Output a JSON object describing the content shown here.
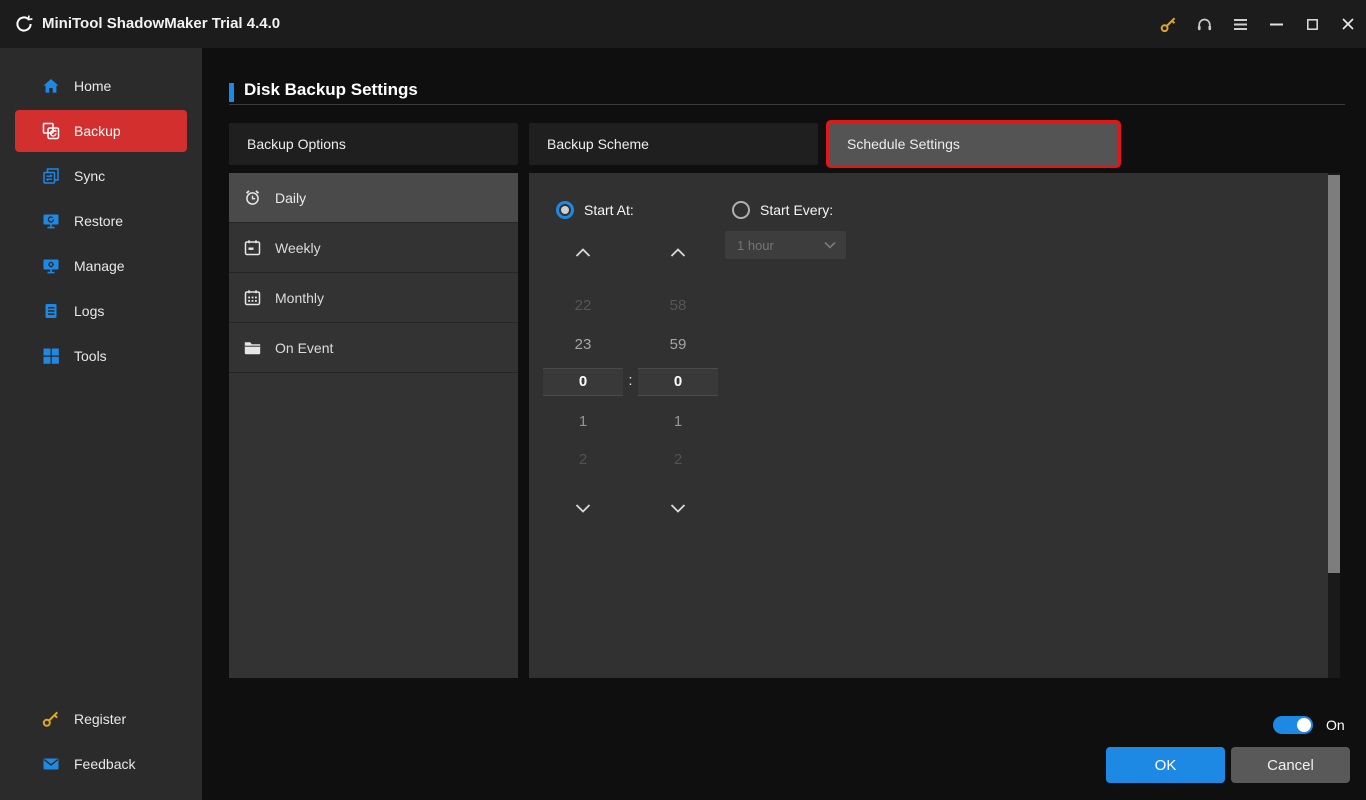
{
  "titlebar": {
    "title": "MiniTool ShadowMaker Trial 4.4.0",
    "icons": [
      "key-icon",
      "headset-icon",
      "menu-icon",
      "minimize-icon",
      "maximize-icon",
      "close-icon"
    ]
  },
  "sidebar": {
    "items": [
      {
        "label": "Home",
        "icon": "home-icon",
        "active": false
      },
      {
        "label": "Backup",
        "icon": "backup-icon",
        "active": true
      },
      {
        "label": "Sync",
        "icon": "sync-icon",
        "active": false
      },
      {
        "label": "Restore",
        "icon": "restore-icon",
        "active": false
      },
      {
        "label": "Manage",
        "icon": "manage-icon",
        "active": false
      },
      {
        "label": "Logs",
        "icon": "logs-icon",
        "active": false
      },
      {
        "label": "Tools",
        "icon": "tools-icon",
        "active": false
      }
    ],
    "bottom_items": [
      {
        "label": "Register",
        "icon": "key-icon"
      },
      {
        "label": "Feedback",
        "icon": "envelope-icon"
      }
    ]
  },
  "page": {
    "title": "Disk Backup Settings"
  },
  "tabs": [
    {
      "label": "Backup Options",
      "selected": false,
      "highlighted": false
    },
    {
      "label": "Backup Scheme",
      "selected": false,
      "highlighted": false
    },
    {
      "label": "Schedule Settings",
      "selected": true,
      "highlighted": true
    }
  ],
  "schedule": {
    "frequencies": [
      {
        "label": "Daily",
        "icon": "alarm-clock-icon",
        "selected": true
      },
      {
        "label": "Weekly",
        "icon": "calendar-week-icon",
        "selected": false
      },
      {
        "label": "Monthly",
        "icon": "calendar-month-icon",
        "selected": false
      },
      {
        "label": "On Event",
        "icon": "folder-icon",
        "selected": false
      }
    ],
    "start_at": {
      "label": "Start At:",
      "selected": true
    },
    "start_every": {
      "label": "Start Every:",
      "selected": false,
      "interval_value": "1 hour",
      "interval_disabled": true
    },
    "time_picker": {
      "hours": {
        "above": [
          "22",
          "23"
        ],
        "selected": "0",
        "below": [
          "1",
          "2"
        ]
      },
      "minutes": {
        "above": [
          "58",
          "59"
        ],
        "selected": "0",
        "below": [
          "1",
          "2"
        ]
      },
      "separator": ":"
    }
  },
  "footer": {
    "toggle_state": "On",
    "ok_label": "OK",
    "cancel_label": "Cancel"
  },
  "colors": {
    "accent_blue": "#1e88e5",
    "brand_red": "#d32f2f",
    "annotation_red": "#e01717",
    "gold": "#dea821",
    "panel_gray": "#333333",
    "selected_gray": "#4a4a4a"
  }
}
